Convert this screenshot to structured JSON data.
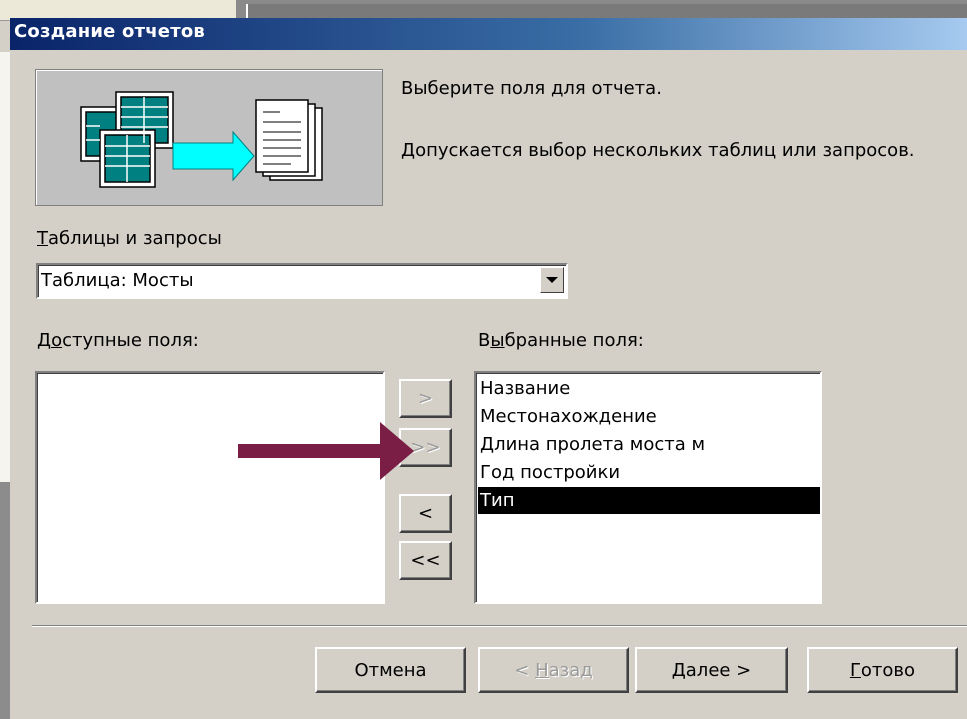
{
  "dialog": {
    "title": "Создание отчетов",
    "intro_line1": "Выберите поля для отчета.",
    "intro_line2": "Допускается выбор нескольких таблиц или запросов."
  },
  "source": {
    "label_underlined": "Т",
    "label_rest": "аблицы и запросы",
    "selected": "Таблица: Мосты"
  },
  "available": {
    "label_pre": "Д",
    "label_underlined": "о",
    "label_rest": "ступные поля:",
    "items": []
  },
  "selected": {
    "label_pre": "В",
    "label_underlined": "ы",
    "label_rest": "бранные поля:",
    "items": [
      "Название",
      "Местонахождение",
      "Длина пролета моста м",
      "Год постройки",
      "Тип"
    ],
    "highlighted": "Тип"
  },
  "transfer_buttons": {
    "add": ">",
    "add_all": ">>",
    "remove": "<",
    "remove_all": "<<"
  },
  "footer": {
    "cancel": "Отмена",
    "back_pre": "< ",
    "back_underlined": "Н",
    "back_rest": "азад",
    "next_underlined": "Д",
    "next_rest": "алее >",
    "finish_underlined": "Г",
    "finish_rest": "отово"
  },
  "colors": {
    "dialog_bg": "#d4d0c8",
    "title_bar": "#0a246a",
    "selection": "#000000",
    "annotation_arrow": "#7b1e45"
  },
  "icons": [
    "report-wizard-illustration",
    "annotation-arrow"
  ]
}
